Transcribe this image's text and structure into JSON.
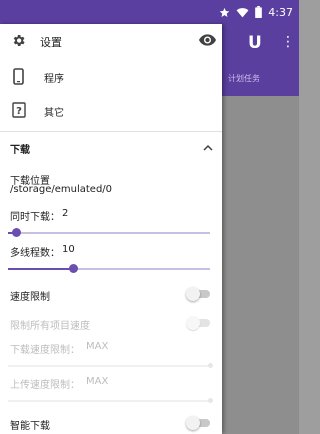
{
  "status_bar": {
    "time": "4:37",
    "icons": [
      "star-icon",
      "wifi-icon",
      "battery-icon"
    ]
  },
  "toolbar": {
    "brand_letter": "U",
    "subtitle": "计划任务"
  },
  "drawer": {
    "header": {
      "label": "设置"
    },
    "menu": [
      {
        "label": "程序",
        "icon": "phone-icon"
      },
      {
        "label": "其它",
        "icon": "help-icon"
      }
    ],
    "section": {
      "title": "下载",
      "download_location": {
        "title": "下载位置",
        "path": "/storage/emulated/0"
      },
      "concurrent_downloads": {
        "label": "同时下载：",
        "value": "2",
        "fraction": 0.04
      },
      "threads": {
        "label": "多线程数：",
        "value": "10",
        "fraction": 0.32
      },
      "speed_limit": {
        "label": "速度限制",
        "on": false
      },
      "limit_all_tasks": {
        "label": "限制所有项目速度",
        "on": false,
        "enabled": false
      },
      "download_speed_limit": {
        "label": "下载速度限制：",
        "value": "MAX",
        "fraction": 1.0
      },
      "upload_speed_limit": {
        "label": "上传速度限制：",
        "value": "MAX",
        "fraction": 1.0
      },
      "smart_download": {
        "label": "智能下载",
        "on": false
      }
    }
  },
  "colors": {
    "accent": "#6a4fb0",
    "status_bar": "#5b3fa0",
    "toolbar": "#5a3f9f"
  }
}
